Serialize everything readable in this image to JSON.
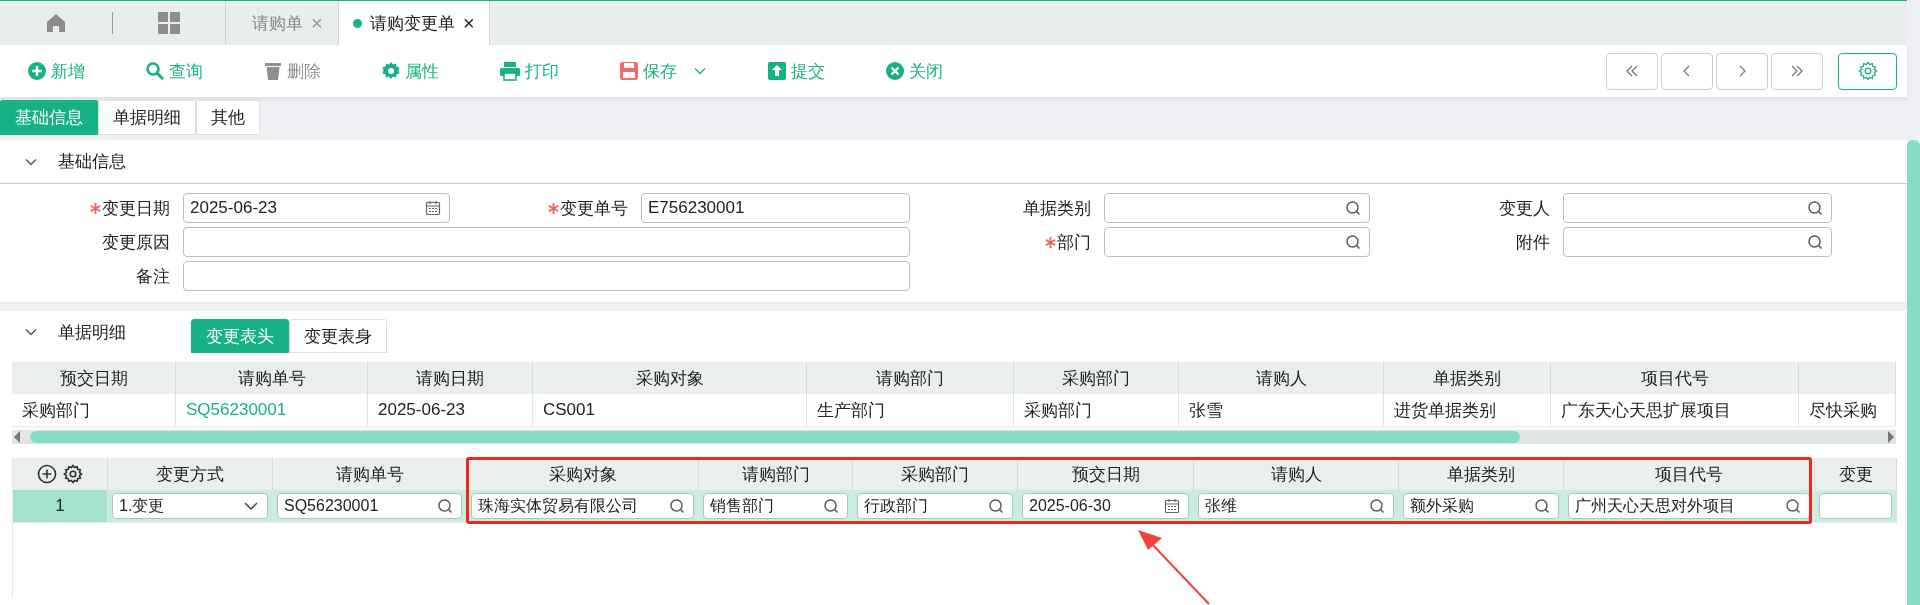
{
  "tab_bar": {
    "tabs": [
      {
        "label": "请购单",
        "close": "×",
        "selected": false
      },
      {
        "label": "请购变更单",
        "close": "×",
        "selected": true
      }
    ]
  },
  "toolbar": {
    "buttons": [
      {
        "kind": "add",
        "label": "新增",
        "disabled": false,
        "dropdown": false
      },
      {
        "kind": "query",
        "label": "查询",
        "disabled": false,
        "dropdown": false
      },
      {
        "kind": "delete",
        "label": "删除",
        "disabled": true,
        "dropdown": false
      },
      {
        "kind": "properties",
        "label": "属性",
        "disabled": false,
        "dropdown": false
      },
      {
        "kind": "print",
        "label": "打印",
        "disabled": false,
        "dropdown": false
      },
      {
        "kind": "save",
        "label": "保存",
        "disabled": false,
        "dropdown": true
      },
      {
        "kind": "submit",
        "label": "提交",
        "disabled": false,
        "dropdown": false
      },
      {
        "kind": "close",
        "label": "关闭",
        "disabled": false,
        "dropdown": false
      }
    ]
  },
  "page_tabs": [
    {
      "label": "基础信息",
      "selected": true
    },
    {
      "label": "单据明细",
      "selected": false
    },
    {
      "label": "其他",
      "selected": false
    }
  ],
  "basic_info": {
    "title": "基础信息",
    "expanded": true,
    "rows": [
      [
        {
          "label": "变更日期",
          "required": true,
          "kind": "date",
          "value": "2025-06-23"
        },
        {
          "label": "变更单号",
          "required": true,
          "kind": "text",
          "value": "E756230001"
        },
        {
          "label": "单据类别",
          "required": false,
          "kind": "lookup"
        },
        {
          "label": "变更人",
          "required": false,
          "kind": "lookup"
        }
      ],
      [
        {
          "label": "变更原因",
          "required": false,
          "kind": "text"
        },
        "",
        {
          "label": "部门",
          "required": true,
          "kind": "lookup"
        },
        {
          "label": "附件",
          "required": false,
          "kind": "lookup"
        }
      ],
      [
        {
          "label": "备注",
          "required": false,
          "kind": "text"
        },
        ""
      ]
    ]
  },
  "detail": {
    "title": "单据明细",
    "expanded": true,
    "tabs": [
      {
        "label": "变更表头",
        "selected": true
      },
      {
        "label": "变更表身",
        "selected": false
      }
    ],
    "request_table": {
      "columns": [
        {
          "label": "预交日期"
        },
        {
          "label": "请购单号"
        },
        {
          "label": "请购日期"
        },
        {
          "label": "采购对象"
        },
        {
          "label": "请购部门"
        },
        {
          "label": "采购部门"
        },
        {
          "label": "请购人"
        },
        {
          "label": "单据类别"
        },
        {
          "label": "项目代号"
        },
        {}
      ],
      "rows": [
        {
          "cells": [
            {
              "kind": "text",
              "text": "采购部门"
            },
            {
              "kind": "link",
              "text": "SQ56230001"
            },
            {
              "kind": "text",
              "text": "2025-06-23"
            },
            {
              "kind": "text",
              "text": "CS001"
            },
            {
              "kind": "text",
              "text": "生产部门"
            },
            {
              "kind": "text",
              "text": "采购部门"
            },
            {
              "kind": "text",
              "text": "张雪"
            },
            {
              "kind": "text",
              "text": "进货单据类别"
            },
            {
              "kind": "text",
              "text": "广东天心天思扩展项目"
            },
            {
              "kind": "text",
              "text": "尽快采购"
            }
          ]
        }
      ]
    },
    "change_table": {
      "columns": [
        {
          "label": "变更方式"
        },
        {
          "label": "请购单号"
        },
        {
          "label": "采购对象"
        },
        {
          "label": "请购部门"
        },
        {
          "label": "采购部门"
        },
        {
          "label": "预交日期"
        },
        {
          "label": "请购人"
        },
        {
          "label": "单据类别"
        },
        {
          "label": "项目代号"
        },
        {
          "label": "变更"
        }
      ],
      "rows": [
        {
          "number": "1",
          "selected": true,
          "cells": [
            {
              "kind": "select",
              "value": "1.变更"
            },
            {
              "kind": "lookup",
              "value": "SQ56230001"
            },
            {
              "kind": "lookup",
              "value": "珠海实体贸易有限公司"
            },
            {
              "kind": "lookup",
              "value": "销售部门"
            },
            {
              "kind": "lookup",
              "value": "行政部门"
            },
            {
              "kind": "date",
              "value": "2025-06-30"
            },
            {
              "kind": "lookup",
              "value": "张维"
            },
            {
              "kind": "lookup",
              "value": "额外采购"
            },
            {
              "kind": "lookup",
              "value": "广州天心天思对外项目"
            },
            {
              "kind": "text"
            }
          ]
        }
      ]
    }
  }
}
